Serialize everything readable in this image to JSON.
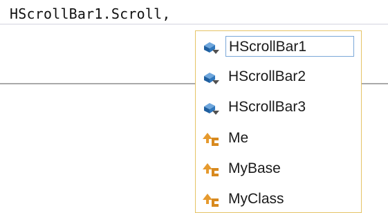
{
  "editor": {
    "code_text": "HScrollBar1.Scroll,"
  },
  "completion": {
    "items": [
      {
        "label": "HScrollBar1",
        "icon": "field-icon",
        "selected": true
      },
      {
        "label": "HScrollBar2",
        "icon": "field-icon",
        "selected": false
      },
      {
        "label": "HScrollBar3",
        "icon": "field-icon",
        "selected": false
      },
      {
        "label": "Me",
        "icon": "keyword-icon",
        "selected": false
      },
      {
        "label": "MyBase",
        "icon": "keyword-icon",
        "selected": false
      },
      {
        "label": "MyClass",
        "icon": "keyword-icon",
        "selected": false
      }
    ]
  },
  "colors": {
    "field_icon": "#2f6fb2",
    "keyword_icon": "#e69a2e",
    "list_border": "#e5c365",
    "selection_border": "#7aa7d8"
  }
}
